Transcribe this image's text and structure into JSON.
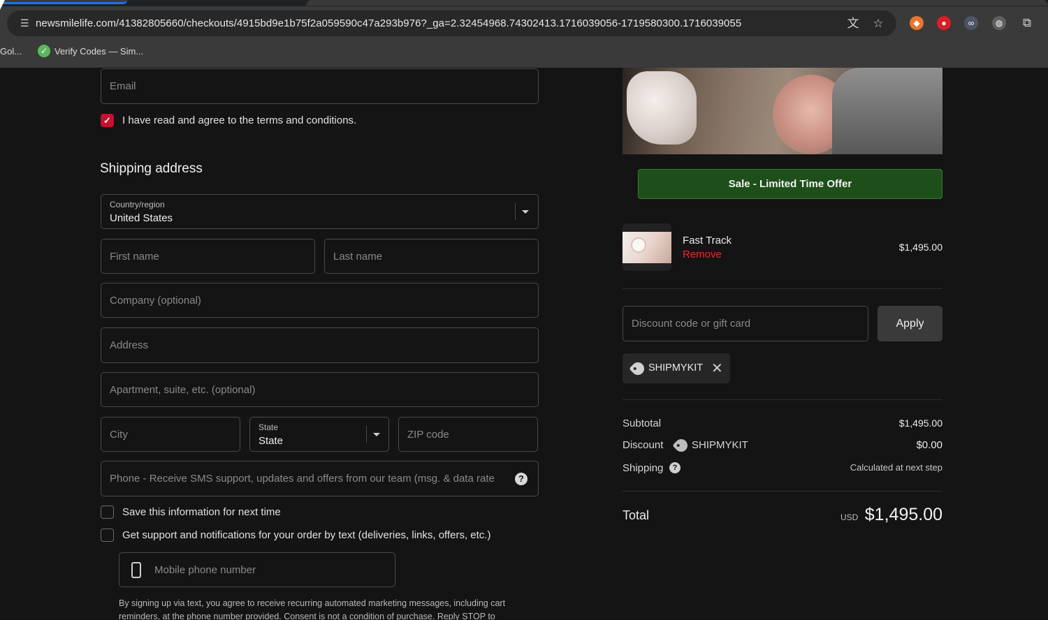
{
  "browser": {
    "url": "newsmilelife.com/41382805660/checkouts/4915bd9e1b75f2a059590c47a293b976?_ga=2.32454968.74302413.1716039056-1719580300.1716039055",
    "bookmarks": [
      "Gol...",
      "Verify Codes — Sim..."
    ],
    "icons": [
      "translate-icon",
      "star-icon",
      "fox-extension-icon",
      "red-shield-extension-icon",
      "glasses-extension-icon",
      "globe-extension-icon",
      "puzzle-extensions-icon"
    ]
  },
  "form": {
    "email_placeholder": "Email",
    "terms_label": "I have read and agree to the terms and conditions.",
    "terms_checked": true,
    "shipping_heading": "Shipping address",
    "country": {
      "label": "Country/region",
      "value": "United States"
    },
    "first_name_placeholder": "First name",
    "last_name_placeholder": "Last name",
    "company_placeholder": "Company (optional)",
    "address_placeholder": "Address",
    "apartment_placeholder": "Apartment, suite, etc. (optional)",
    "city_placeholder": "City",
    "state": {
      "label": "State",
      "value": "State"
    },
    "zip_placeholder": "ZIP code",
    "phone_placeholder": "Phone - Receive SMS support, updates and offers from our team (msg. & data rate",
    "save_info_label": "Save this information for next time",
    "sms_label": "Get support and notifications for your order by text (deliveries, links, offers, etc.)",
    "mobile_placeholder": "Mobile phone number",
    "fine_print": "By signing up via text, you agree to receive recurring automated marketing messages, including cart reminders, at the phone number provided. Consent is not a condition of purchase. Reply STOP to"
  },
  "summary": {
    "sale_button": "Sale - Limited Time Offer",
    "item": {
      "name": "Fast Track",
      "remove_label": "Remove",
      "price": "$1,495.00"
    },
    "discount_placeholder": "Discount code or gift card",
    "apply_label": "Apply",
    "applied_code": "SHIPMYKIT",
    "rows": {
      "subtotal_label": "Subtotal",
      "subtotal_value": "$1,495.00",
      "discount_label": "Discount",
      "discount_code": "SHIPMYKIT",
      "discount_value": "$0.00",
      "shipping_label": "Shipping",
      "shipping_value": "Calculated at next step"
    },
    "total_label": "Total",
    "currency": "USD",
    "total_value": "$1,495.00"
  },
  "colors": {
    "accent_red": "#c8102e",
    "remove_red": "#e52d2d",
    "sale_green": "#1e4f1a",
    "background": "#141414"
  }
}
